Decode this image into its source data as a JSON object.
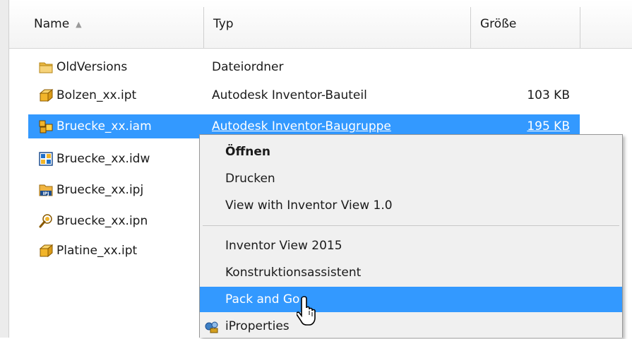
{
  "columns": {
    "name": "Name",
    "type": "Typ",
    "size": "Größe"
  },
  "files": [
    {
      "name": "OldVersions",
      "type": "Dateiordner",
      "size": "",
      "icon": "folder-icon"
    },
    {
      "name": "Bolzen_xx.ipt",
      "type": "Autodesk Inventor-Bauteil",
      "size": "103 KB",
      "icon": "inventor-part-icon"
    },
    {
      "name": "Bruecke_xx.iam",
      "type": "Autodesk Inventor-Baugruppe",
      "size": "195 KB",
      "icon": "inventor-assembly-icon",
      "selected": true
    },
    {
      "name": "Bruecke_xx.idw",
      "type": "",
      "size": "",
      "icon": "inventor-drawing-icon"
    },
    {
      "name": "Bruecke_xx.ipj",
      "type": "",
      "size": "",
      "icon": "inventor-project-icon"
    },
    {
      "name": "Bruecke_xx.ipn",
      "type": "",
      "size": "",
      "icon": "inventor-presentation-icon"
    },
    {
      "name": "Platine_xx.ipt",
      "type": "",
      "size": "",
      "icon": "inventor-part-icon"
    }
  ],
  "context_menu": {
    "items": [
      {
        "label": "Öffnen",
        "bold": true
      },
      {
        "label": "Drucken"
      },
      {
        "label": "View with Inventor View 1.0"
      },
      {
        "label": "Inventor View 2015"
      },
      {
        "label": "Konstruktionsassistent"
      },
      {
        "label": "Pack and Go",
        "highlighted": true
      },
      {
        "label": "iProperties",
        "icon": "iproperties-icon"
      }
    ]
  },
  "colors": {
    "selection": "#3399ff",
    "menu_background": "#f0f0f0",
    "part_icon": "#f2b52a"
  }
}
